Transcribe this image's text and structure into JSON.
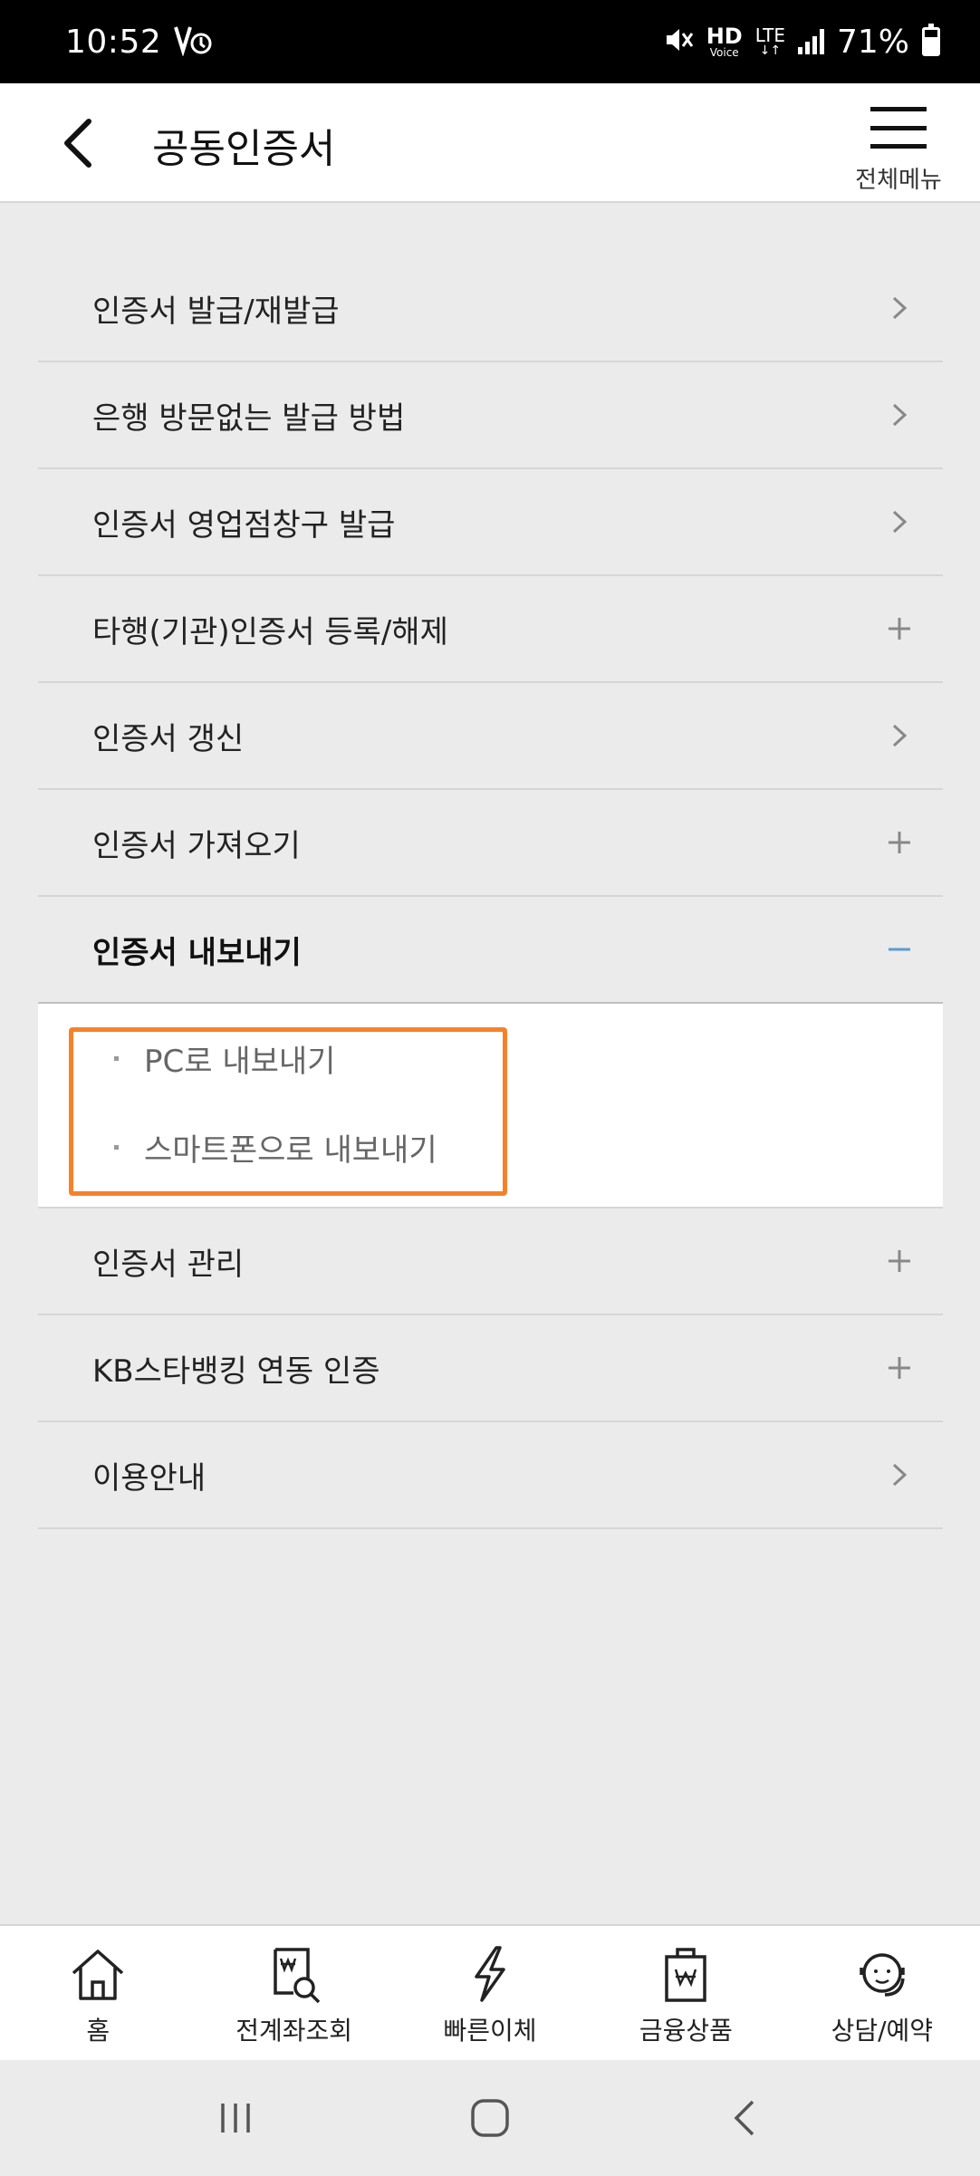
{
  "status_bar": {
    "time": "10:52",
    "hd_label": "HD",
    "voice_label": "Voice",
    "lte_label": "LTE",
    "battery": "71%"
  },
  "header": {
    "title": "공동인증서",
    "menu_label": "전체메뉴"
  },
  "menu": {
    "items": [
      {
        "label": "인증서 발급/재발급",
        "indicator": "chevron-right"
      },
      {
        "label": "은행 방문없는 발급 방법",
        "indicator": "chevron-right"
      },
      {
        "label": "인증서 영업점창구 발급",
        "indicator": "chevron-right"
      },
      {
        "label": "타행(기관)인증서 등록/해제",
        "indicator": "plus"
      },
      {
        "label": "인증서 갱신",
        "indicator": "chevron-right"
      },
      {
        "label": "인증서 가져오기",
        "indicator": "plus"
      },
      {
        "label": "인증서 내보내기",
        "indicator": "minus",
        "expanded": true,
        "subitems": [
          "PC로 내보내기",
          "스마트폰으로 내보내기"
        ]
      },
      {
        "label": "인증서 관리",
        "indicator": "plus"
      },
      {
        "label": "KB스타뱅킹 연동 인증",
        "indicator": "plus"
      },
      {
        "label": "이용안내",
        "indicator": "chevron-right"
      }
    ]
  },
  "colors": {
    "highlight": "#f5822a",
    "active_minus": "#5b9bd5"
  },
  "bottom_nav": [
    {
      "label": "홈",
      "icon": "home-icon"
    },
    {
      "label": "전계좌조회",
      "icon": "account-search-icon"
    },
    {
      "label": "빠른이체",
      "icon": "lightning-icon"
    },
    {
      "label": "금융상품",
      "icon": "product-bag-icon"
    },
    {
      "label": "상담/예약",
      "icon": "headset-icon"
    }
  ]
}
